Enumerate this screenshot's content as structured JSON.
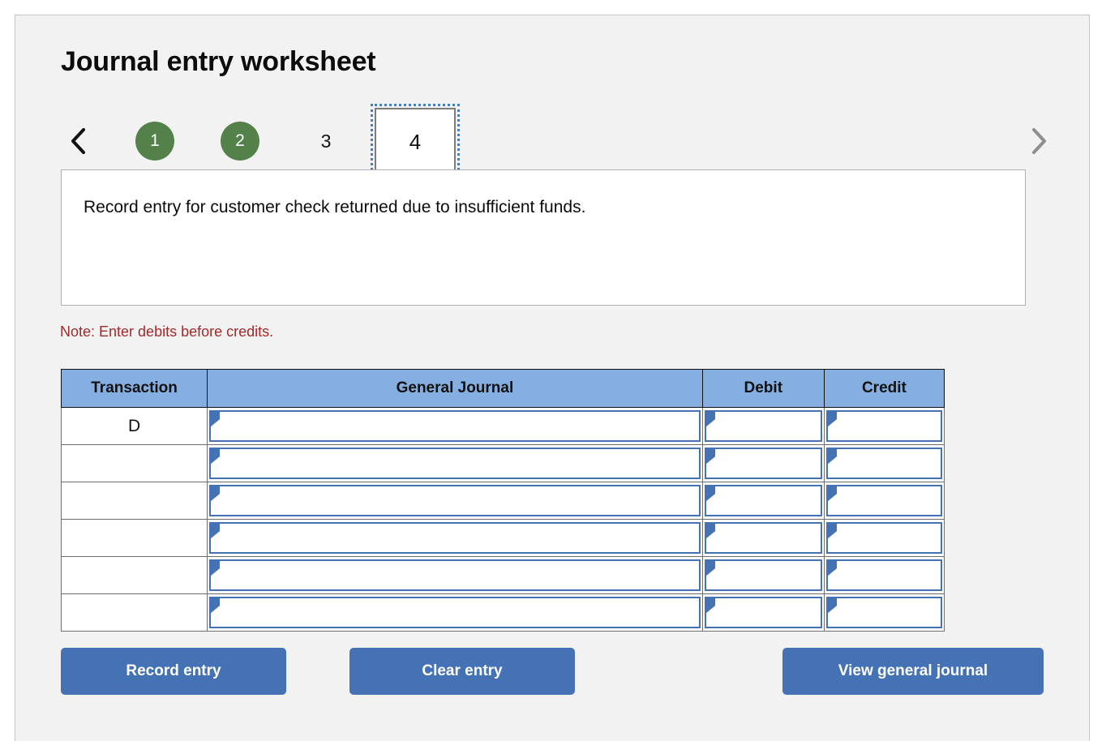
{
  "page": {
    "title": "Journal entry worksheet"
  },
  "pager": {
    "prev_icon": "chevron-left-icon",
    "next_icon": "chevron-right-icon",
    "steps": [
      {
        "label": "1",
        "state": "completed"
      },
      {
        "label": "2",
        "state": "completed"
      },
      {
        "label": "3",
        "state": "inactive"
      },
      {
        "label": "4",
        "state": "current"
      }
    ]
  },
  "description": {
    "text": "Record entry for customer check returned due to insufficient funds."
  },
  "note": {
    "text": "Note: Enter debits before credits."
  },
  "table": {
    "headers": {
      "transaction": "Transaction",
      "general_journal": "General Journal",
      "debit": "Debit",
      "credit": "Credit"
    },
    "rows": [
      {
        "transaction": "D",
        "general_journal": "",
        "debit": "",
        "credit": ""
      },
      {
        "transaction": "",
        "general_journal": "",
        "debit": "",
        "credit": ""
      },
      {
        "transaction": "",
        "general_journal": "",
        "debit": "",
        "credit": ""
      },
      {
        "transaction": "",
        "general_journal": "",
        "debit": "",
        "credit": ""
      },
      {
        "transaction": "",
        "general_journal": "",
        "debit": "",
        "credit": ""
      },
      {
        "transaction": "",
        "general_journal": "",
        "debit": "",
        "credit": ""
      }
    ]
  },
  "buttons": {
    "record": "Record entry",
    "clear": "Clear entry",
    "view": "View general journal"
  },
  "colors": {
    "panel_background": "#f2f2f2",
    "step_completed": "#54804a",
    "focus_ring": "#4a7ebb",
    "note_text": "#a02b2b",
    "table_header": "#85afe0",
    "field_border": "#4572b4",
    "button": "#4572b4"
  }
}
